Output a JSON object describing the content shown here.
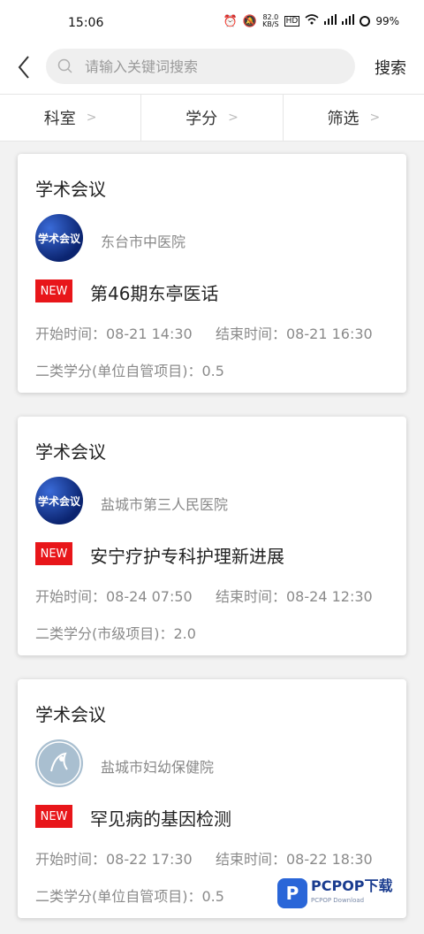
{
  "status_bar": {
    "time": "15:06",
    "net_speed_value": "82.0",
    "net_speed_unit": "KB/S",
    "hd_label": "HD",
    "battery": "99%"
  },
  "search": {
    "placeholder": "请输入关键词搜索",
    "value": "",
    "submit_label": "搜索"
  },
  "filters": [
    {
      "label": "科室"
    },
    {
      "label": "学分"
    },
    {
      "label": "筛选"
    }
  ],
  "cards": [
    {
      "category": "学术会议",
      "avatar_text": "学术会议",
      "organization": "东台市中医院",
      "badge": "NEW",
      "title": "第46期东亭医话",
      "start": "开始时间：08-21 14:30",
      "end": "结束时间：08-21 16:30",
      "credit": "二类学分(单位自管项目)：0.5"
    },
    {
      "category": "学术会议",
      "avatar_text": "学术会议",
      "organization": "盐城市第三人民医院",
      "badge": "NEW",
      "title": "安宁疗护专科护理新进展",
      "start": "开始时间：08-24 07:50",
      "end": "结束时间：08-24 12:30",
      "credit": "二类学分(市级项目)：2.0"
    },
    {
      "category": "学术会议",
      "avatar_text": "",
      "organization": "盐城市妇幼保健院",
      "badge": "NEW",
      "title": "罕见病的基因检测",
      "start": "开始时间：08-22 17:30",
      "end": "结束时间：08-22 18:30",
      "credit": "二类学分(单位自管项目)：0.5"
    }
  ],
  "watermark": {
    "logo_letter": "P",
    "brand": "PCPOP下载",
    "sub": "PCPOP Download"
  },
  "colors": {
    "badge": "#e8161a",
    "background": "#f2f2f2"
  }
}
